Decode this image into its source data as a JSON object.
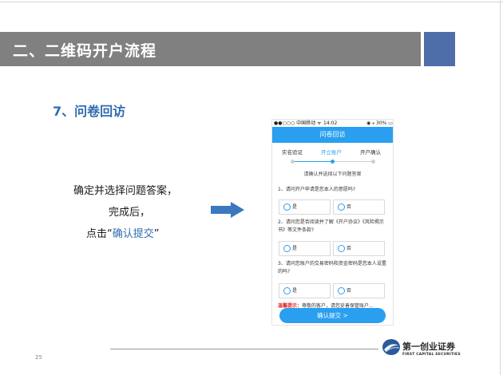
{
  "slide": {
    "title": "二、二维码开户流程",
    "section": "7、问卷回访",
    "instructions": {
      "line1": "确定并选择问题答案，",
      "line2": "完成后，",
      "line3_prefix": "点击“",
      "line3_highlight": "确认提交",
      "line3_suffix": "”"
    },
    "page_number": "25"
  },
  "phone": {
    "status": {
      "carrier": "●●○○○ 中国移动 ᯤ",
      "time": "14:02",
      "battery": "◉ ⁎ 30% ▭"
    },
    "header_title": "问卷回访",
    "steps": [
      {
        "label": "实名验证",
        "active": false
      },
      {
        "label": "开立账户",
        "active": true
      },
      {
        "label": "开户确认",
        "active": false
      }
    ],
    "subtitle": "请确认并选择以下问题答案",
    "questions": [
      {
        "text": "1、请问开户申请是您本人的意愿吗?",
        "options": [
          "是",
          "否"
        ]
      },
      {
        "text": "2、请问您是否阅读并了解《开户协议》《风险揭示书》等文件条款?",
        "options": [
          "是",
          "否"
        ]
      },
      {
        "text": "3、请问您账户的交易密码和资金密码是您本人设置的吗?",
        "options": [
          "是",
          "否"
        ]
      }
    ],
    "warning": {
      "label": "温馨提示：",
      "text": "尊敬的客户，请您妥善保管账户..."
    },
    "submit_label": "确认提交 >"
  },
  "logo": {
    "name_cn": "第一创业证券",
    "name_en": "FIRST CAPITAL SECURITIES"
  },
  "colors": {
    "title_bar": "#808080",
    "accent": "#4d6ea8",
    "app_blue": "#2a9ff0",
    "heading_blue": "#2f6cb0",
    "arrow": "#3a78c0"
  }
}
